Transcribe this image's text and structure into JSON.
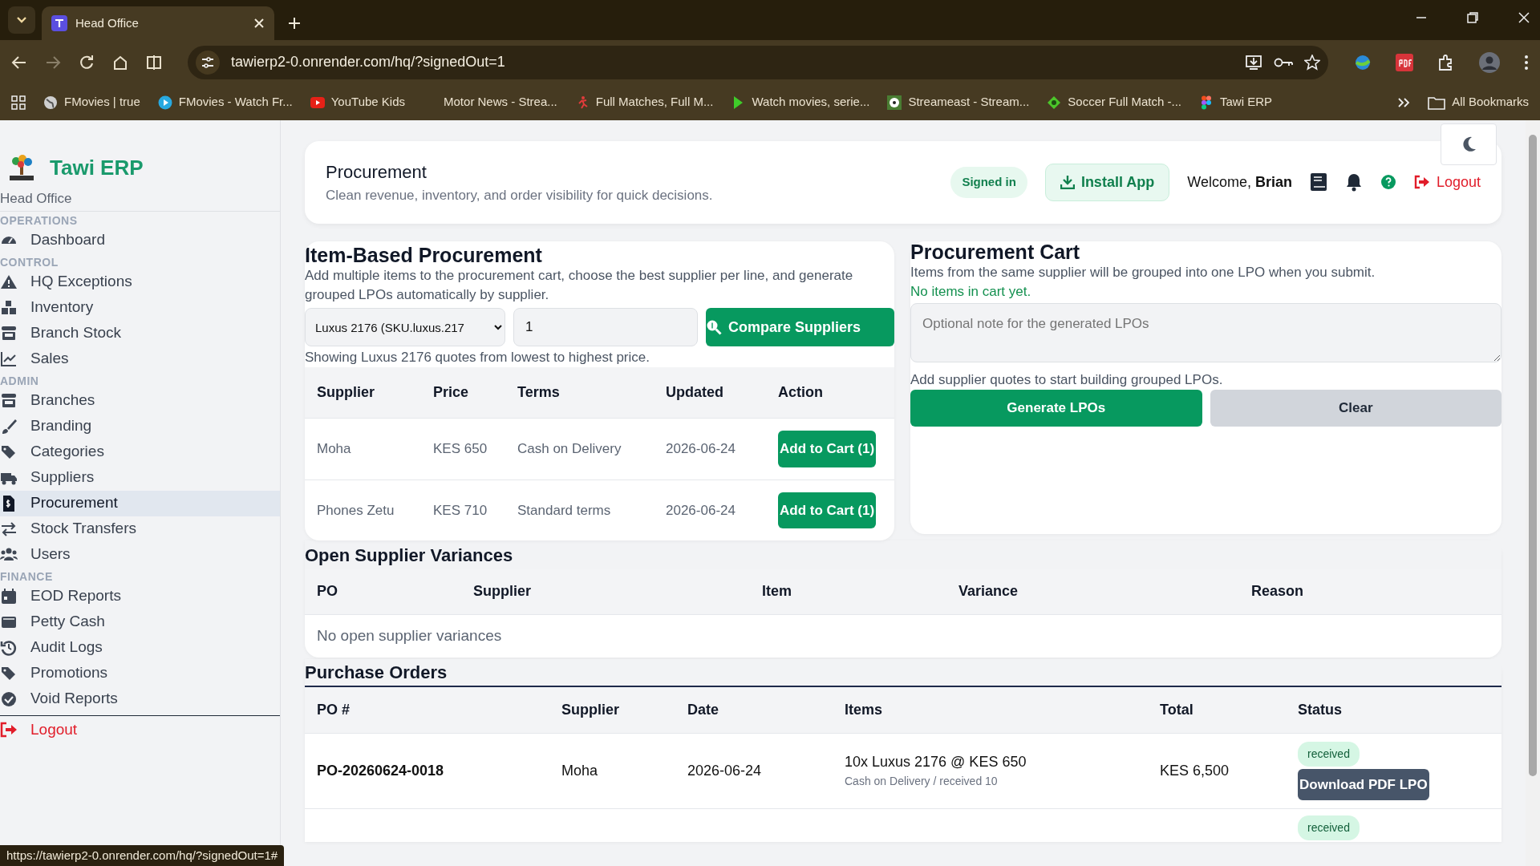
{
  "browser": {
    "tab_title": "Head Office",
    "url": "tawierp2-0.onrender.com/hq/?signedOut=1",
    "bookmarks": [
      {
        "label": "FMovies | true"
      },
      {
        "label": "FMovies - Watch Fr..."
      },
      {
        "label": "YouTube Kids"
      },
      {
        "label": "Motor News - Strea..."
      },
      {
        "label": "Full Matches, Full M..."
      },
      {
        "label": "Watch movies, serie..."
      },
      {
        "label": "Streameast - Stream..."
      },
      {
        "label": "Soccer Full Match -..."
      },
      {
        "label": "Tawi ERP"
      }
    ],
    "all_bookmarks": "All Bookmarks",
    "status_url": "https://tawierp2-0.onrender.com/hq/?signedOut=1#"
  },
  "sidebar": {
    "brand": "Tawi ERP",
    "branch": "Head Office",
    "sections": [
      {
        "heading": "OPERATIONS",
        "items": [
          {
            "label": "Dashboard",
            "selected": false
          }
        ]
      },
      {
        "heading": "CONTROL",
        "items": [
          {
            "label": "HQ Exceptions",
            "selected": false
          },
          {
            "label": "Inventory",
            "selected": false
          },
          {
            "label": "Branch Stock",
            "selected": false
          },
          {
            "label": "Sales",
            "selected": false
          }
        ]
      },
      {
        "heading": "ADMIN",
        "items": [
          {
            "label": "Branches",
            "selected": false
          },
          {
            "label": "Branding",
            "selected": false
          },
          {
            "label": "Categories",
            "selected": false
          },
          {
            "label": "Suppliers",
            "selected": false
          },
          {
            "label": "Procurement",
            "selected": true
          },
          {
            "label": "Stock Transfers",
            "selected": false
          },
          {
            "label": "Users",
            "selected": false
          }
        ]
      },
      {
        "heading": "FINANCE",
        "items": [
          {
            "label": "EOD Reports",
            "selected": false
          },
          {
            "label": "Petty Cash",
            "selected": false
          },
          {
            "label": "Audit Logs",
            "selected": false
          },
          {
            "label": "Promotions",
            "selected": false
          },
          {
            "label": "Void Reports",
            "selected": false
          }
        ]
      }
    ],
    "logout": "Logout"
  },
  "header": {
    "title": "Procurement",
    "subtitle": "Clean revenue, inventory, and order visibility for quick decisions.",
    "status_badge": "Signed in",
    "install_button": "Install App",
    "welcome": "Welcome,",
    "user": "Brian",
    "logout": "Logout"
  },
  "item_procurement": {
    "title": "Item-Based Procurement",
    "description": "Add multiple items to the procurement cart, choose the best supplier per line, and generate grouped LPOs automatically by supplier.",
    "item_select": "Luxus 2176 (SKU.luxus.217",
    "quantity": "1",
    "compare_button": "Compare Suppliers",
    "showing": "Showing Luxus 2176 quotes from lowest to highest price.",
    "columns": [
      "Supplier",
      "Price",
      "Terms",
      "Updated",
      "Action"
    ],
    "rows": [
      {
        "supplier": "Moha",
        "price": "KES 650",
        "terms": "Cash on Delivery",
        "updated": "2026-06-24",
        "action": "Add to Cart (1)"
      },
      {
        "supplier": "Phones Zetu",
        "price": "KES 710",
        "terms": "Standard terms",
        "updated": "2026-06-24",
        "action": "Add to Cart (1)"
      }
    ]
  },
  "cart": {
    "title": "Procurement Cart",
    "description": "Items from the same supplier will be grouped into one LPO when you submit.",
    "empty": "No items in cart yet.",
    "note_placeholder": "Optional note for the generated LPOs",
    "hint": "Add supplier quotes to start building grouped LPOs.",
    "generate_button": "Generate LPOs",
    "clear_button": "Clear"
  },
  "variances": {
    "title": "Open Supplier Variances",
    "columns": [
      "PO",
      "Supplier",
      "Item",
      "Variance",
      "Reason"
    ],
    "empty": "No open supplier variances"
  },
  "purchase_orders": {
    "title": "Purchase Orders",
    "columns": [
      "PO #",
      "Supplier",
      "Date",
      "Items",
      "Total",
      "Status"
    ],
    "rows": [
      {
        "po": "PO-20260624-0018",
        "supplier": "Moha",
        "date": "2026-06-24",
        "items": "10x Luxus 2176 @ KES 650",
        "items_detail": "Cash on Delivery / received 10",
        "total": "KES 6,500",
        "status": "received",
        "action": "Download PDF LPO"
      },
      {
        "status": "received"
      }
    ]
  }
}
